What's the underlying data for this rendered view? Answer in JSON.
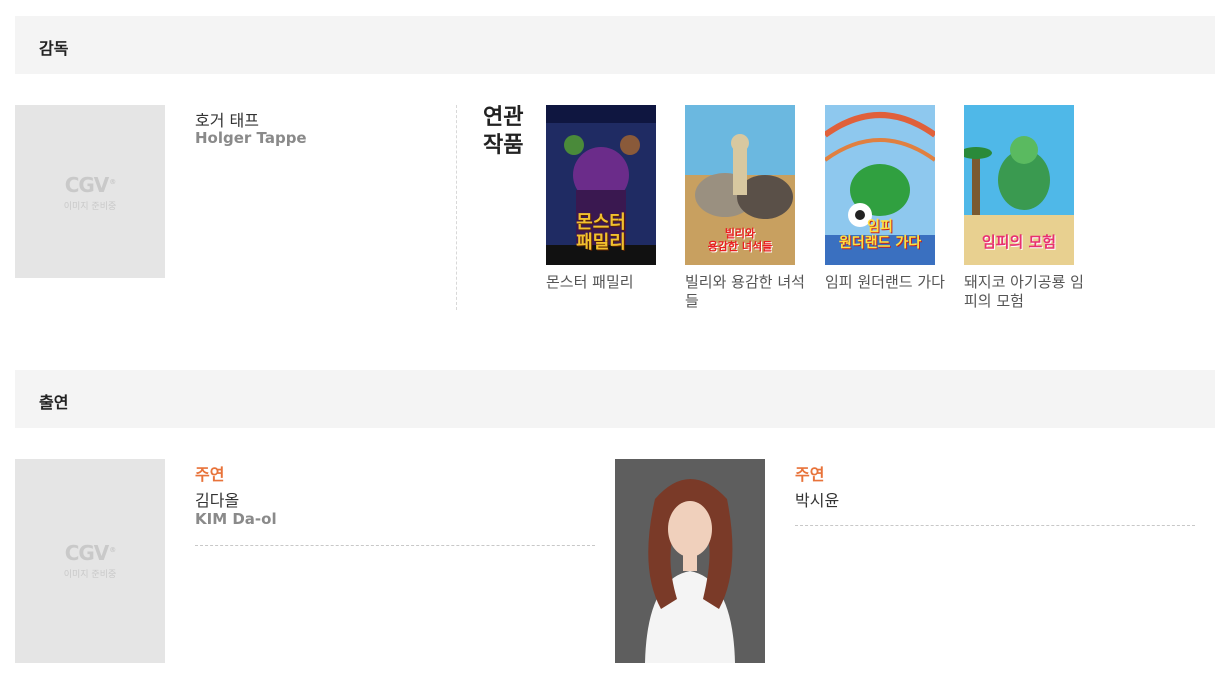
{
  "director_section": {
    "title": "감독",
    "person": {
      "placeholder_logo": "CGV",
      "placeholder_text": "이미지 준비중",
      "name_ko": "호거 태프",
      "name_en": "Holger Tappe"
    },
    "related_label": "연관\n작품",
    "related_works": [
      {
        "title": "몬스터 패밀리",
        "poster_text": "몬스터\n패밀리",
        "poster_colors": [
          "#1f2b63",
          "#6b2c8a",
          "#f2c12e"
        ]
      },
      {
        "title": "빌리와 용감한 녀석들",
        "poster_text": "빌리와\n용감한 녀석들",
        "poster_colors": [
          "#6bb8e0",
          "#c8a060",
          "#e8c040"
        ]
      },
      {
        "title": "임피 원더랜드 가다",
        "poster_text": "임피\n원더랜드 가다",
        "poster_colors": [
          "#8ec8ee",
          "#e0603a",
          "#30a040"
        ]
      },
      {
        "title": "돼지코 아기공룡 임피의 모험",
        "poster_text": "임피의 모험",
        "poster_colors": [
          "#4fb8e8",
          "#e8d090",
          "#3a9a50"
        ]
      }
    ]
  },
  "cast_section": {
    "title": "출연",
    "actors": [
      {
        "role": "주연",
        "name_ko": "김다올",
        "name_en": "KIM Da-ol",
        "placeholder_logo": "CGV",
        "placeholder_text": "이미지 준비중"
      },
      {
        "role": "주연",
        "name_ko": "박시윤",
        "name_en": ""
      }
    ]
  }
}
